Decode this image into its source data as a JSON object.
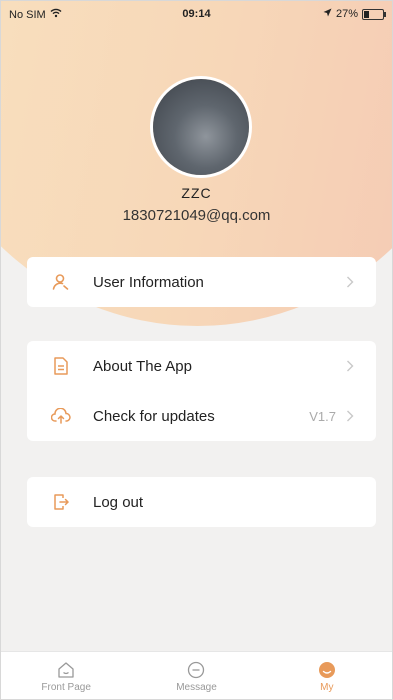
{
  "status": {
    "carrier": "No SIM",
    "time": "09:14",
    "battery": "27%",
    "battery_level": 0.27
  },
  "profile": {
    "name": "ZZC",
    "email": "1830721049@qq.com"
  },
  "menu": {
    "user_info": {
      "label": "User Information",
      "icon": "user-icon"
    },
    "about": {
      "label": "About The App",
      "icon": "document-icon"
    },
    "updates": {
      "label": "Check for updates",
      "value": "V1.7",
      "icon": "cloud-upload-icon"
    },
    "logout": {
      "label": "Log out",
      "icon": "logout-icon"
    }
  },
  "tabs": [
    {
      "label": "Front Page",
      "icon": "home-icon",
      "active": false
    },
    {
      "label": "Message",
      "icon": "message-icon",
      "active": false
    },
    {
      "label": "My",
      "icon": "profile-icon",
      "active": true
    }
  ],
  "colors": {
    "accent": "#e89a5a",
    "hero_start": "#f8e2c0",
    "hero_end": "#f4c7b3"
  }
}
